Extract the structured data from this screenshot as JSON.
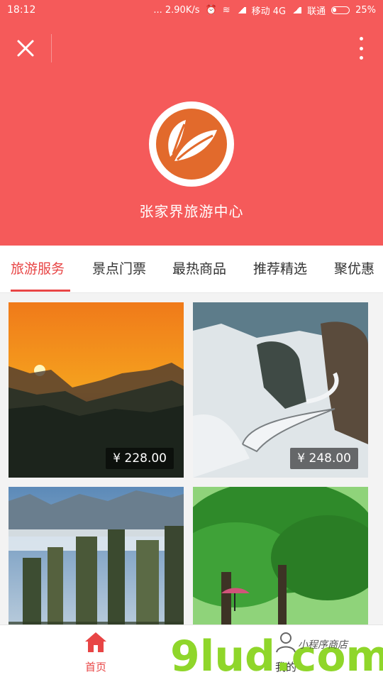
{
  "status": {
    "time": "18:12",
    "speed": "... 2.90K/s",
    "carrier1": "移动 4G",
    "carrier2": "联通",
    "battery": "25%",
    "battery_level": 0.25
  },
  "header": {
    "store_name": "张家界旅游中心",
    "accent_color": "#f55a5a",
    "logo_color": "#e26a2c"
  },
  "tabs": [
    {
      "label": "旅游服务",
      "active": true
    },
    {
      "label": "景点门票",
      "active": false
    },
    {
      "label": "最热商品",
      "active": false
    },
    {
      "label": "推荐精选",
      "active": false
    },
    {
      "label": "聚优惠",
      "active": false
    }
  ],
  "products": [
    {
      "price": "¥ 228.00",
      "scene": "sunset-mountains"
    },
    {
      "price": "¥ 248.00",
      "scene": "snowy-winding-road"
    },
    {
      "price": "",
      "scene": "stone-pillars-clouds"
    },
    {
      "price": "",
      "scene": "green-tree-lake"
    }
  ],
  "tabbar": {
    "home_label": "首页",
    "mine_label": "我的"
  },
  "watermark": {
    "text1": "9lud.com",
    "text2": "小程序商店"
  }
}
